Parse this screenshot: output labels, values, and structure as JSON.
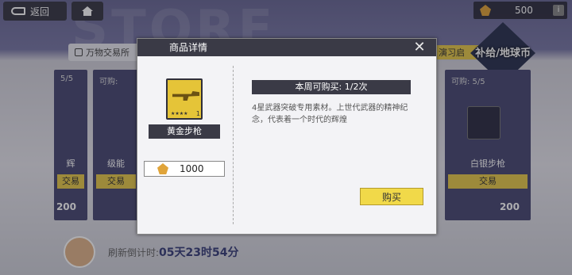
{
  "topbar": {
    "back_label": "返回",
    "coins": "500",
    "info_label": "i"
  },
  "bg_title": "STORE",
  "nav": {
    "left_category": "万物交易所",
    "right_category": "演习启",
    "toggle_label": "补给/地球币"
  },
  "cards": [
    {
      "buy_limit": "5/5",
      "name": "辉",
      "action": "交易",
      "price": "200"
    },
    {
      "buy_limit": "可购:",
      "name": "级能",
      "action": "交易",
      "price": ""
    },
    {
      "buy_limit": "可购: 5/5",
      "name": "白银步枪",
      "action": "交易",
      "price": "200"
    }
  ],
  "footer": {
    "refresh_label": "刷新倒计时:",
    "refresh_time": "05天23时54分"
  },
  "modal": {
    "title": "商品详情",
    "item_name": "黄金步枪",
    "item_level": "1",
    "price": "1000",
    "limit_text": "本周可购买: 1/2次",
    "description": "4星武器突破专用素材。上世代武器的精神纪念，代表着一个时代的辉煌",
    "buy_label": "购买"
  }
}
